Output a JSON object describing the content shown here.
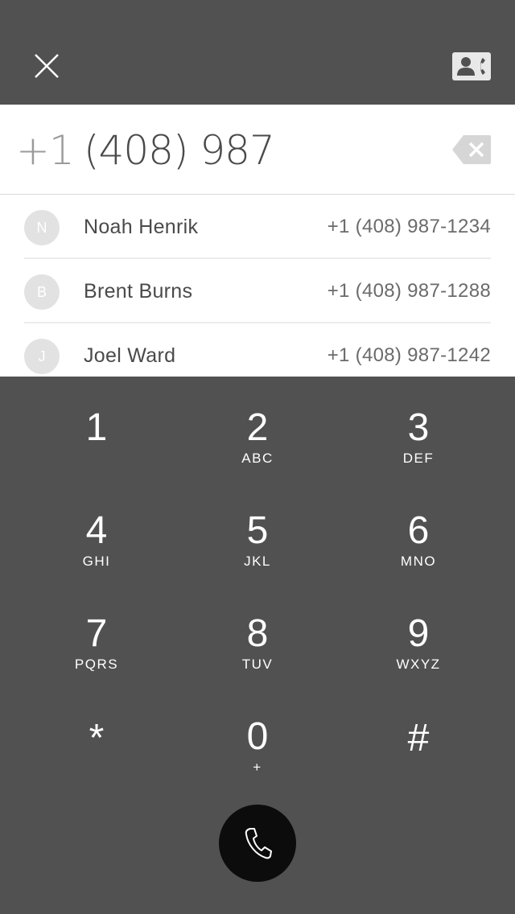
{
  "header": {
    "close_icon": "close-icon",
    "contacts_icon": "contacts-call-icon"
  },
  "dial": {
    "country_code": "+1",
    "number": "(408) 987",
    "backspace_icon": "backspace-icon"
  },
  "results": [
    {
      "initial": "N",
      "name": "Noah Henrik",
      "phone": "+1 (408) 987-1234"
    },
    {
      "initial": "B",
      "name": "Brent Burns",
      "phone": "+1 (408) 987-1288"
    },
    {
      "initial": "J",
      "name": "Joel Ward",
      "phone": "+1 (408) 987-1242"
    }
  ],
  "keypad": [
    {
      "digit": "1",
      "letters": ""
    },
    {
      "digit": "2",
      "letters": "ABC"
    },
    {
      "digit": "3",
      "letters": "DEF"
    },
    {
      "digit": "4",
      "letters": "GHI"
    },
    {
      "digit": "5",
      "letters": "JKL"
    },
    {
      "digit": "6",
      "letters": "MNO"
    },
    {
      "digit": "7",
      "letters": "PQRS"
    },
    {
      "digit": "8",
      "letters": "TUV"
    },
    {
      "digit": "9",
      "letters": "WXYZ"
    },
    {
      "digit": "*",
      "letters": ""
    },
    {
      "digit": "0",
      "letters": "+"
    },
    {
      "digit": "#",
      "letters": ""
    }
  ],
  "call_button": {
    "icon": "phone-icon"
  },
  "colors": {
    "dark_bg": "#515151",
    "call_button": "#0c0c0c",
    "avatar": "#e2e2e2"
  }
}
